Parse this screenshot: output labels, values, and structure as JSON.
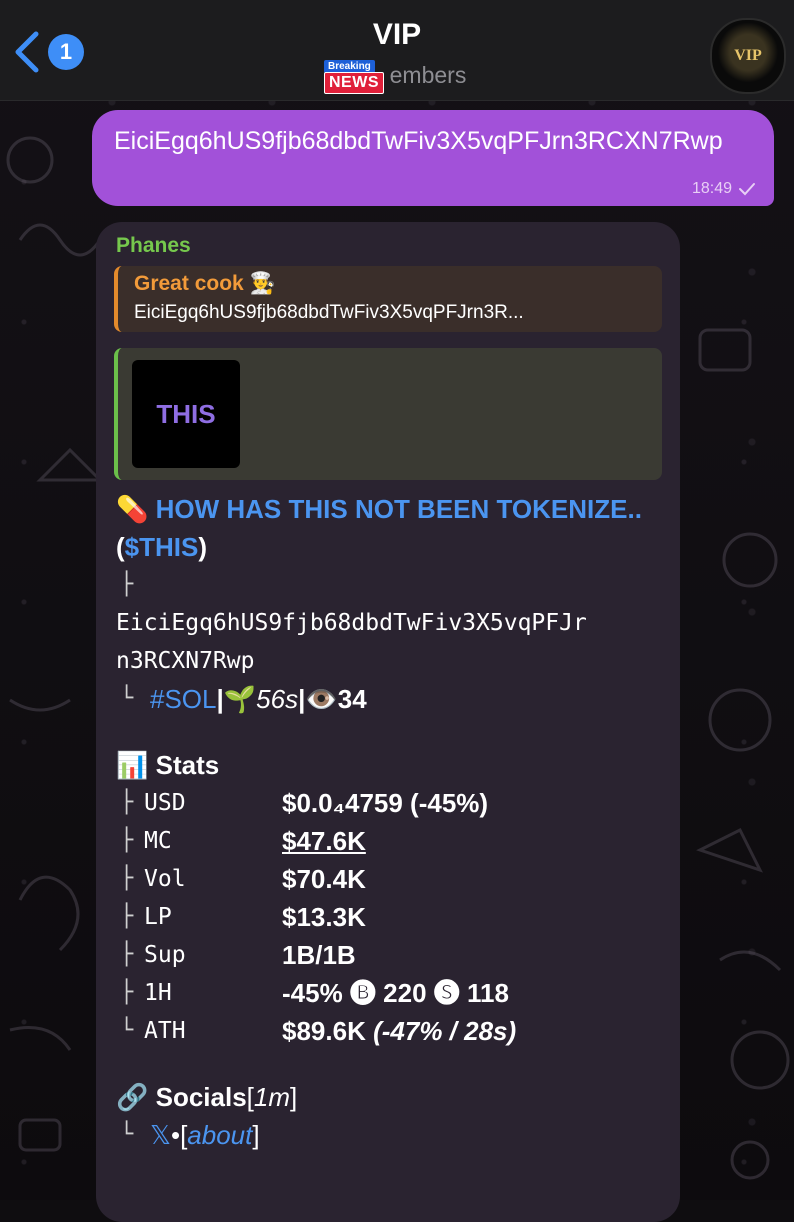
{
  "header": {
    "back_count": "1",
    "title": "VIP",
    "subtitle": "embers",
    "news_badge_top": "Breaking",
    "news_badge_bottom": "NEWS",
    "avatar_text": "VIP"
  },
  "outgoing": {
    "text": "EiciEgq6hUS9fjb68dbdTwFiv3X5vqPFJrn3RCXN7Rwp",
    "time": "18:49"
  },
  "incoming": {
    "sender": "Phanes",
    "reply_name": "Great cook 👨‍🍳",
    "reply_text": "EiciEgq6hUS9fjb68dbdTwFiv3X5vqPFJrn3R...",
    "thumb_text": "THIS",
    "pill_emoji": "💊",
    "headline": "HOW HAS THIS NOT BEEN TOKENIZE..",
    "ticker_open": " (",
    "ticker": "$THIS",
    "ticker_close": ")",
    "tree_branch": "├",
    "tree_end": "└",
    "address_line1": "EiciEgq6hUS9fjb68dbdTwFiv3X5vqPFJr",
    "address_line2": "n3RCXN7Rwp",
    "chain": "#SOL",
    "sep": " | ",
    "sprout_emoji": "🌱",
    "age": "56s",
    "eye_emoji": "👁️",
    "views": "34",
    "stats_emoji": "📊",
    "stats_title": "Stats",
    "stats": [
      {
        "label": "USD",
        "value": "$0.0₄4759 (-45%)"
      },
      {
        "label": "MC",
        "value": "$47.6K"
      },
      {
        "label": "Vol",
        "value": "$70.4K"
      },
      {
        "label": "LP",
        "value": "$13.3K"
      },
      {
        "label": "Sup",
        "value": "1B/1B"
      },
      {
        "label": "1H",
        "value": "-45% 🅑 220 🅢 118"
      },
      {
        "label": "ATH",
        "value": "$89.6K",
        "extra": "(-47% / 28s)"
      }
    ],
    "socials_emoji": "🔗",
    "socials_title": "Socials",
    "socials_open": " [",
    "socials_time": "1m",
    "socials_close": "]",
    "x_icon": "𝕏",
    "bullet": " • ",
    "about_open": "[",
    "about": "about",
    "about_close": "]"
  }
}
